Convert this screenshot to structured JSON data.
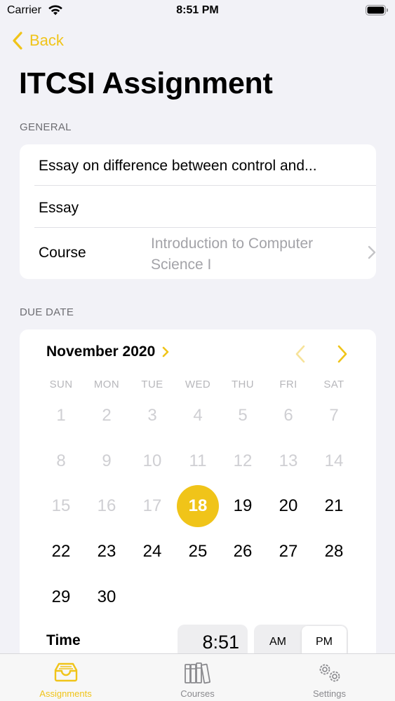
{
  "status_bar": {
    "carrier": "Carrier",
    "time": "8:51 PM"
  },
  "nav": {
    "back_label": "Back"
  },
  "title": "ITCSI Assignment",
  "general": {
    "header": "GENERAL",
    "title_value": "Essay on difference between control and...",
    "type_value": "Essay",
    "course_label": "Course",
    "course_value": "Introduction to Computer Science I"
  },
  "due_date": {
    "header": "DUE DATE",
    "month_label": "November 2020",
    "weekdays": [
      "SUN",
      "MON",
      "TUE",
      "WED",
      "THU",
      "FRI",
      "SAT"
    ],
    "days": [
      "1",
      "2",
      "3",
      "4",
      "5",
      "6",
      "7",
      "8",
      "9",
      "10",
      "11",
      "12",
      "13",
      "14",
      "15",
      "16",
      "17",
      "18",
      "19",
      "20",
      "21",
      "22",
      "23",
      "24",
      "25",
      "26",
      "27",
      "28",
      "29",
      "30"
    ],
    "selected_day": "18",
    "time_label": "Time",
    "time_value": "8:51",
    "am_label": "AM",
    "pm_label": "PM",
    "selected_period": "PM"
  },
  "tabs": [
    {
      "label": "Assignments",
      "icon": "tray-icon",
      "active": true
    },
    {
      "label": "Courses",
      "icon": "books-icon",
      "active": false
    },
    {
      "label": "Settings",
      "icon": "gears-icon",
      "active": false
    }
  ],
  "colors": {
    "accent": "#f0c419",
    "background": "#f2f2f7",
    "secondary_text": "#a3a3a8"
  }
}
